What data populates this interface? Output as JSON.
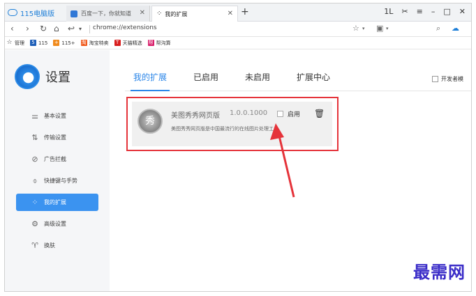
{
  "browser": {
    "brand": "115电脑版",
    "tabs": [
      {
        "title": "百度一下，你就知道",
        "active": false
      },
      {
        "title": "我的扩展",
        "active": true
      }
    ],
    "new_tab": "+",
    "window_controls": [
      "1L",
      "✂",
      "≡",
      "–",
      "□",
      "✕"
    ],
    "address": "chrome://extensions",
    "bookmarks": [
      {
        "label": "管理",
        "icon": "star-icon",
        "color": "#333333"
      },
      {
        "label": "115",
        "icon": "115-icon",
        "color": "#1e5fb8"
      },
      {
        "label": "115+",
        "icon": "115plus-icon",
        "color": "#f08a1c"
      },
      {
        "label": "淘宝特卖",
        "icon": "taobao-icon",
        "color": "#f05a1c"
      },
      {
        "label": "天猫精选",
        "icon": "tmall-icon",
        "color": "#d81e1e"
      },
      {
        "label": "帮沟算",
        "icon": "bookmark-icon",
        "color": "#d81e6a"
      }
    ]
  },
  "sidebar": {
    "title": "设置",
    "items": [
      {
        "label": "基本设置",
        "icon": "sliders-icon",
        "active": false
      },
      {
        "label": "传输设置",
        "icon": "transfer-icon",
        "active": false
      },
      {
        "label": "广告拦截",
        "icon": "ad-block-icon",
        "active": false
      },
      {
        "label": "快捷键与手势",
        "icon": "mouse-icon",
        "active": false
      },
      {
        "label": "我的扩展",
        "icon": "extensions-icon",
        "active": true
      },
      {
        "label": "高级设置",
        "icon": "gear-icon",
        "active": false
      },
      {
        "label": "换肤",
        "icon": "shirt-icon",
        "active": false
      }
    ]
  },
  "content": {
    "tabs": [
      {
        "label": "我的扩展",
        "active": true
      },
      {
        "label": "已启用",
        "active": false
      },
      {
        "label": "未启用",
        "active": false
      },
      {
        "label": "扩展中心",
        "active": false
      }
    ],
    "developer_mode": "开发者模",
    "extension": {
      "icon_glyph": "秀",
      "name": "美图秀秀网页版",
      "version": "1.0.0.1000",
      "description": "美图秀秀网页版是中国最流行的在线图片处理工具",
      "enable_label": "启用",
      "enabled": false
    }
  },
  "watermark": "最需网",
  "colors": {
    "accent": "#2b86e8",
    "highlight_box": "#e5333a",
    "watermark": "#3a2cc8"
  }
}
